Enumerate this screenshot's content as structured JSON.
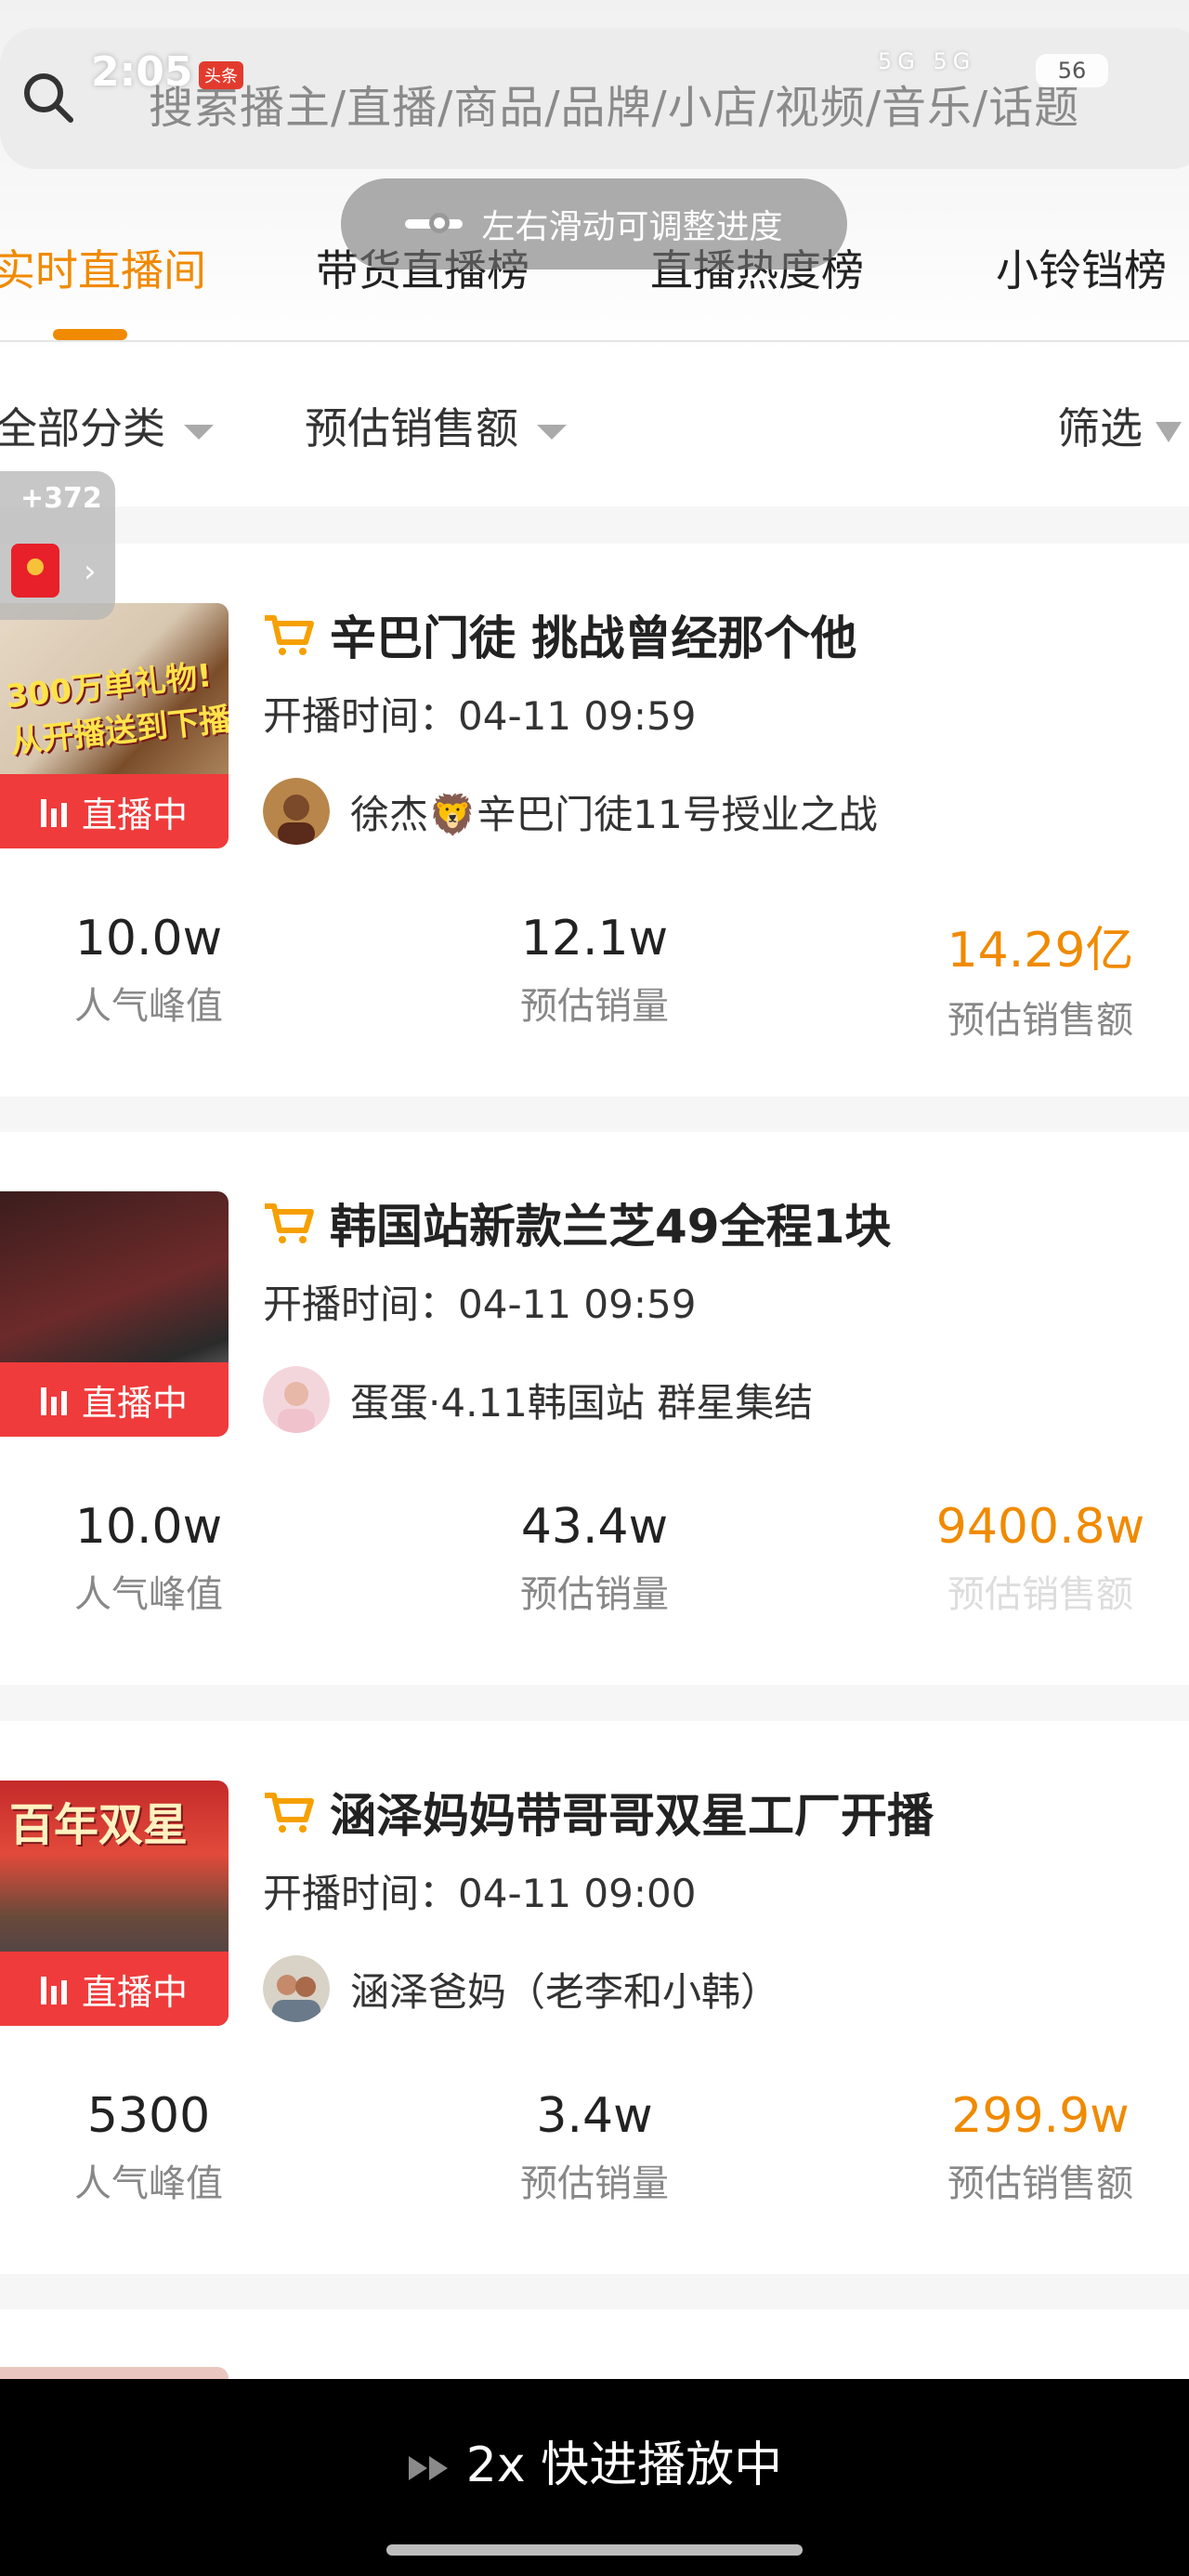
{
  "status_bar": {
    "time": "2:05",
    "badge": "头条",
    "signal": "5G 5G",
    "battery": "56"
  },
  "search": {
    "placeholder": "搜索播主/直播/商品/品牌/小店/视频/音乐/话题"
  },
  "toast": {
    "text": "左右滑动可调整进度"
  },
  "tabs": [
    {
      "label": "实时直播间",
      "active": true
    },
    {
      "label": "带货直播榜",
      "active": false
    },
    {
      "label": "直播热度榜",
      "active": false
    },
    {
      "label": "小铃铛榜",
      "active": false
    }
  ],
  "filters": {
    "category": "全部分类",
    "sort": "预估销售额",
    "filter": "筛选"
  },
  "red_packet": {
    "count": "+372"
  },
  "live_label": "直播中",
  "stat_labels": {
    "peak": "人气峰值",
    "volume": "预估销量",
    "sales": "预估销售额"
  },
  "cards": [
    {
      "title": "辛巴门徒 挑战曾经那个他",
      "start_time": "开播时间：04-11 09:59",
      "host": "徐杰🦁辛巴门徒11号授业之战",
      "thumb_text": "300万单礼物!\n从开播送到下播!",
      "peak": "10.0w",
      "volume": "12.1w",
      "sales": "14.29亿"
    },
    {
      "title": "韩国站新款兰芝49全程1块",
      "start_time": "开播时间：04-11 09:59",
      "host": "蛋蛋·4.11韩国站 群星集结",
      "thumb_text": "",
      "peak": "10.0w",
      "volume": "43.4w",
      "sales": "9400.8w"
    },
    {
      "title": "涵泽妈妈带哥哥双星工厂开播",
      "start_time": "开播时间：04-11 09:00",
      "host": "涵泽爸妈（老李和小韩）",
      "thumb_text": "百年双星",
      "peak": "5300",
      "volume": "3.4w",
      "sales": "299.9w"
    }
  ],
  "bottom_bar": {
    "label": "2x 快进播放中"
  },
  "colors": {
    "accent": "#f08a00",
    "live_red": "#ef3b3b"
  }
}
